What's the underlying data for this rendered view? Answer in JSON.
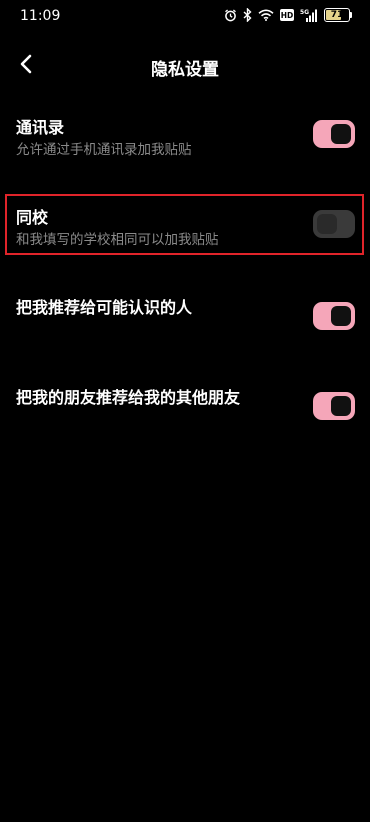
{
  "status_bar": {
    "time": "11:09",
    "icons": [
      "alarm-icon",
      "bluetooth-icon",
      "wifi-icon",
      "hd-icon",
      "signal-icon",
      "battery-icon"
    ],
    "hd_label": "HD",
    "network_label": "5G",
    "battery_level": "71",
    "battery_fraction": 0.71
  },
  "header": {
    "back_icon": "chevron-left-icon",
    "title": "隐私设置"
  },
  "settings": [
    {
      "title": "通讯录",
      "description": "允许通过手机通讯录加我贴贴",
      "enabled": true
    },
    {
      "title": "同校",
      "description": "和我填写的学校相同可以加我贴贴",
      "enabled": false
    },
    {
      "title": "把我推荐给可能认识的人",
      "description": "",
      "enabled": true
    },
    {
      "title": "把我的朋友推荐给我的其他朋友",
      "description": "",
      "enabled": true
    }
  ],
  "colors": {
    "background": "#000000",
    "toggle_on": "#f5a6b9",
    "toggle_off": "#3a3a3a",
    "highlight": "#e0242a",
    "secondary_text": "#8a8a8a"
  }
}
